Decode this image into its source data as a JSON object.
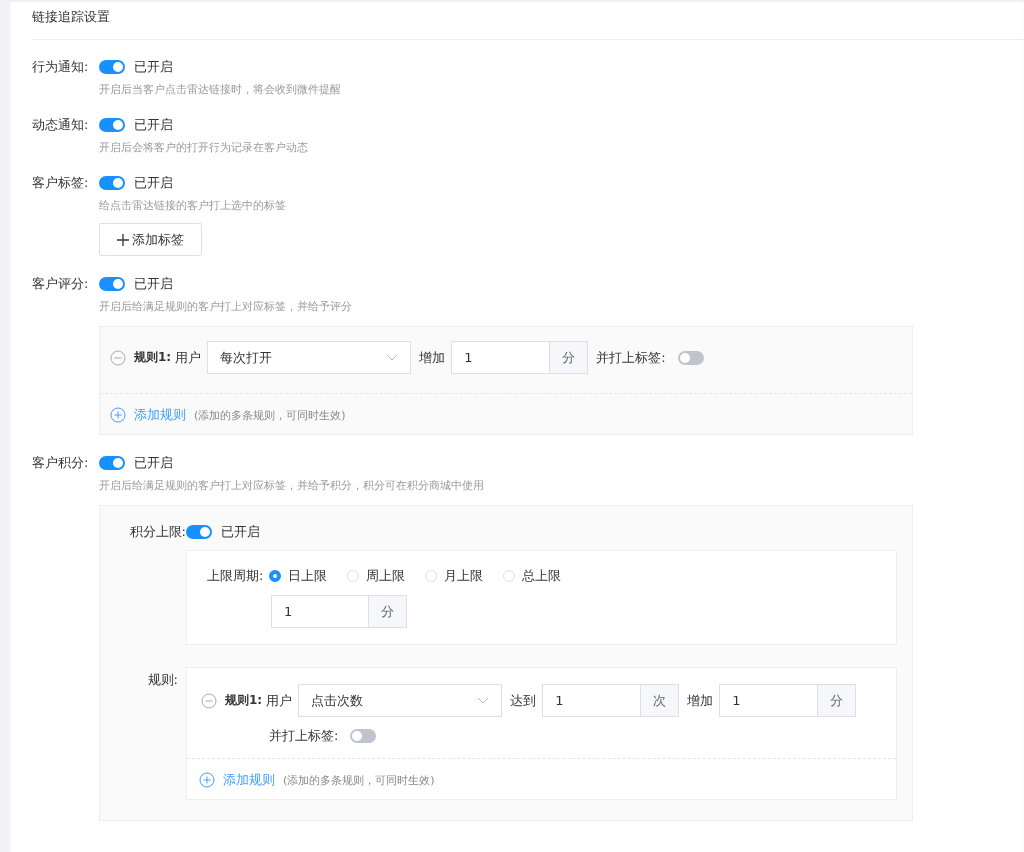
{
  "title": "链接追踪设置",
  "settings": [
    {
      "kind": "plain",
      "label": "行为通知:",
      "on": true,
      "status": "已开启",
      "hint": "开启后当客户点击雷达链接时，将会收到微件提醒"
    },
    {
      "kind": "plain",
      "label": "动态通知:",
      "on": true,
      "status": "已开启",
      "hint": "开启后会将客户的打开行为记录在客户动态"
    },
    {
      "kind": "tags",
      "label": "客户标签:",
      "on": true,
      "status": "已开启",
      "hint": "给点击雷达链接的客户打上选中的标签",
      "button": "添加标签"
    },
    {
      "kind": "score",
      "label": "客户评分:",
      "on": true,
      "status": "已开启",
      "hint": "开启后给满足规则的客户打上对应标签，并给予评分"
    },
    {
      "kind": "points",
      "label": "客户积分:",
      "on": true,
      "status": "已开启",
      "hint": "开启后给满足规则的客户打上对应标签，并给予积分，积分可在积分商城中使用"
    }
  ],
  "score": {
    "rules": [
      {
        "label": "规则1:",
        "prefix": "用户",
        "select": "每次打开",
        "action": "增加",
        "value": "1",
        "unit": "分",
        "tag_label": "并打上标签:",
        "tag_on": false
      }
    ],
    "add_rule": "添加规则",
    "add_hint": "(添加的多条规则，可同时生效)"
  },
  "points": {
    "cap": {
      "label": "积分上限:",
      "on": true,
      "status": "已开启",
      "period_label": "上限周期:",
      "periods": [
        {
          "label": "日上限",
          "selected": true
        },
        {
          "label": "周上限",
          "selected": false
        },
        {
          "label": "月上限",
          "selected": false
        },
        {
          "label": "总上限",
          "selected": false
        }
      ],
      "value": "1",
      "unit": "分"
    },
    "rules_label": "规则:",
    "rules": [
      {
        "label": "规则1:",
        "prefix": "用户",
        "select": "点击次数",
        "reach": "达到",
        "reach_value": "1",
        "reach_unit": "次",
        "action": "增加",
        "value": "1",
        "unit": "分",
        "tag_label": "并打上标签:",
        "tag_on": false
      }
    ],
    "add_rule": "添加规则",
    "add_hint": "(添加的多条规则，可同时生效)"
  }
}
